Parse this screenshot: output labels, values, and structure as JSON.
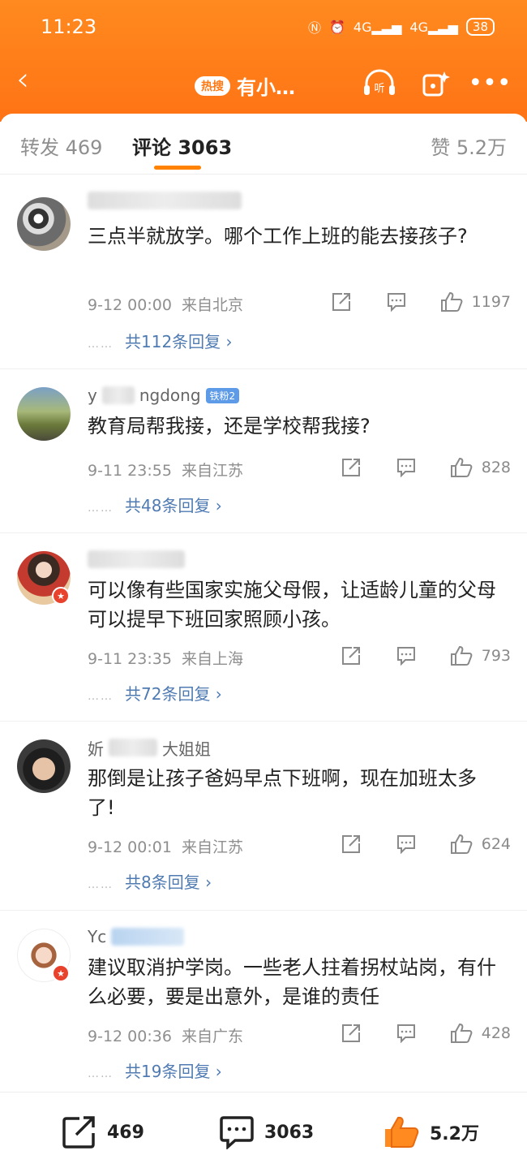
{
  "status_bar": {
    "time": "11:23",
    "network": "4G",
    "battery": "38"
  },
  "nav": {
    "hot_badge": "热搜",
    "title": "有小…",
    "listen_label": "听"
  },
  "tabs": {
    "repost": "转发 469",
    "comments": "评论 3063",
    "likes": "赞 5.2万"
  },
  "comments": [
    {
      "name": "",
      "badge": "",
      "text": "三点半就放学。哪个工作上班的能去接孩子?",
      "date": "9-12 00:00",
      "location": "来自北京",
      "likes": "1197",
      "replies": "共112条回复"
    },
    {
      "name": "y",
      "name_tail": "ngdong",
      "badge": "铁粉2",
      "text": "教育局帮我接，还是学校帮我接?",
      "date": "9-11 23:55",
      "location": "来自江苏",
      "likes": "828",
      "replies": "共48条回复"
    },
    {
      "name": "",
      "badge": "",
      "text": "可以像有些国家实施父母假，让适龄儿童的父母可以提早下班回家照顾小孩。",
      "date": "9-11 23:35",
      "location": "来自上海",
      "likes": "793",
      "replies": "共72条回复"
    },
    {
      "name": "妡",
      "name_tail": "大姐姐",
      "badge": "",
      "text": "那倒是让孩子爸妈早点下班啊，现在加班太多了!",
      "date": "9-12 00:01",
      "location": "来自江苏",
      "likes": "624",
      "replies": "共8条回复"
    },
    {
      "name": "Yc",
      "badge": "",
      "text": "建议取消护学岗。一些老人拄着拐杖站岗，有什么必要，要是出意外，是谁的责任",
      "date": "9-12 00:36",
      "location": "来自广东",
      "likes": "428",
      "replies": "共19条回复"
    }
  ],
  "bottom_bar": {
    "repost": "469",
    "comment": "3063",
    "like": "5.2万"
  },
  "colors": {
    "brand": "#ff7a14",
    "link": "#4f7bb2",
    "like_active": "#ff8a1f"
  }
}
